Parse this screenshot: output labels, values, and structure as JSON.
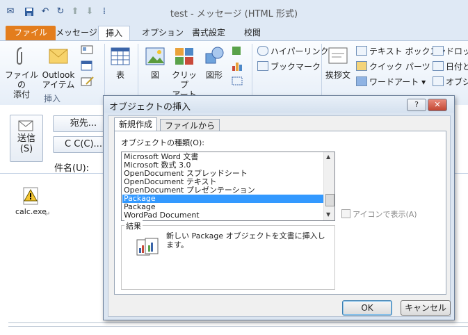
{
  "window": {
    "title": "test - メッセージ (HTML 形式)"
  },
  "tabs": [
    {
      "label": "ファイル"
    },
    {
      "label": "メッセージ"
    },
    {
      "label": "挿入"
    },
    {
      "label": "オプション"
    },
    {
      "label": "書式設定"
    },
    {
      "label": "校閲"
    }
  ],
  "ribbon": {
    "attach_file": "ファイルの\n添付",
    "outlook_item": "Outlook\nアイテム",
    "group_insert": "挿入",
    "table": "表",
    "picture": "図",
    "clipart": "クリップ\nアート",
    "shapes": "図形",
    "hyperlink": "ハイパーリンク",
    "bookmark": "ブックマーク",
    "greeting": "挨拶文",
    "textbox": "テキスト ボックス",
    "quickparts": "クイック パーツ",
    "wordart": "ワードアート",
    "dropcap": "ドロップ",
    "datetime": "日付と",
    "object": "オブジェ"
  },
  "compose": {
    "send": "送信\n(S)",
    "to": "宛先...",
    "cc": "C C(C)...",
    "subject_label": "件名(U):",
    "attachment_name": "calc.exe"
  },
  "dialog": {
    "title": "オブジェクトの挿入",
    "help": "?",
    "close": "✕",
    "tab_new": "新規作成",
    "tab_file": "ファイルから",
    "type_label": "オブジェクトの種類(O):",
    "items": [
      "Microsoft Word 文書",
      "Microsoft 数式 3.0",
      "OpenDocument スプレッドシート",
      "OpenDocument テキスト",
      "OpenDocument プレゼンテーション",
      "Package",
      "Package",
      "WordPad Document"
    ],
    "selected_index": 5,
    "display_as_icon": "アイコンで表示(A)",
    "result_label": "結果",
    "result_text": "新しい Package オブジェクトを文書に挿入します。",
    "ok": "OK",
    "cancel": "キャンセル"
  }
}
